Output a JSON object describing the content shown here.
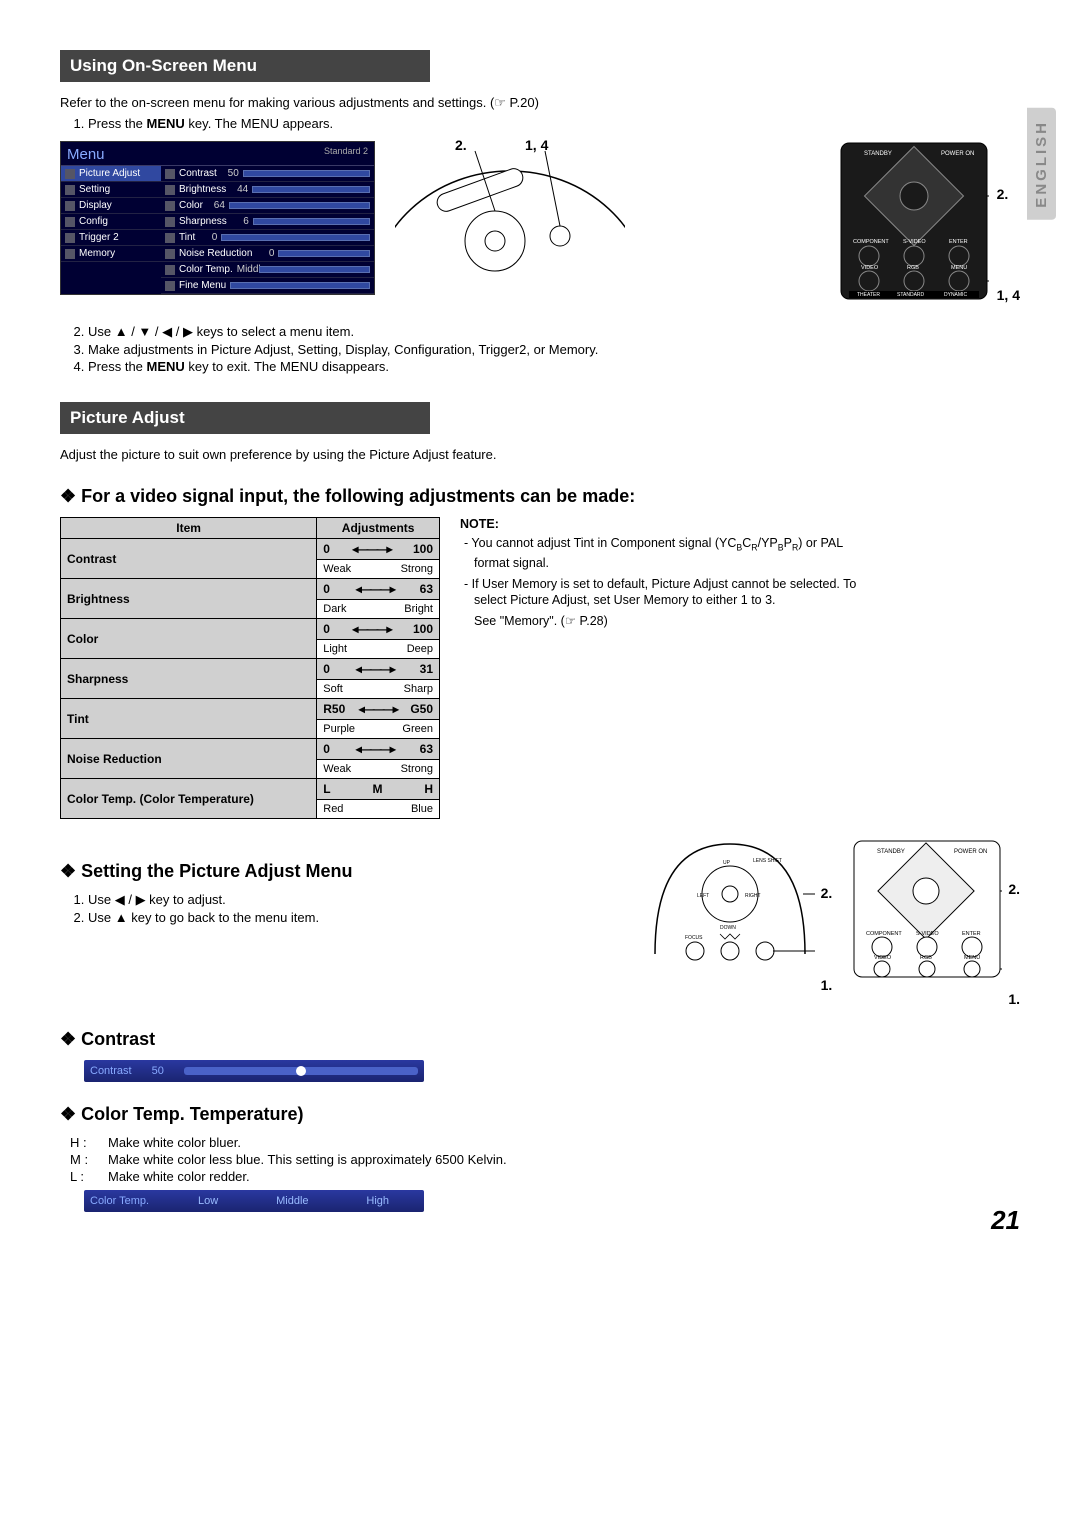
{
  "page_number": "21",
  "language_tab": "ENGLISH",
  "sections": {
    "using_menu": {
      "title": "Using On-Screen Menu",
      "intro": "Refer to the on-screen menu for making various adjustments and settings. (☞ P.20)",
      "step1": "Press the MENU key. The MENU appears.",
      "step2": "Use ▲ / ▼ / ◀ / ▶ keys to select a menu item.",
      "step3": "Make adjustments in Picture Adjust, Setting, Display, Configuration, Trigger2, or Memory.",
      "step4": "Press the MENU key to exit. The MENU disappears.",
      "menu": {
        "title": "Menu",
        "mode": "Standard 2",
        "left_items": [
          "Picture Adjust",
          "Setting",
          "Display",
          "Config",
          "Trigger 2",
          "Memory"
        ],
        "right_items": [
          {
            "label": "Contrast",
            "val": "50"
          },
          {
            "label": "Brightness",
            "val": "44"
          },
          {
            "label": "Color",
            "val": "64"
          },
          {
            "label": "Sharpness",
            "val": "6"
          },
          {
            "label": "Tint",
            "val": "0"
          },
          {
            "label": "Noise Reduction",
            "val": "0"
          },
          {
            "label": "Color Temp.",
            "val": "Middle"
          },
          {
            "label": "Fine Menu",
            "val": ""
          }
        ]
      },
      "callout_2": "2.",
      "callout_14": "1, 4"
    },
    "picture_adjust": {
      "title": "Picture Adjust",
      "intro": "Adjust the picture to suit own preference by using the Picture Adjust feature.",
      "video_heading": "For a video signal input, the following adjustments can be made:",
      "table": {
        "head_item": "Item",
        "head_adj": "Adjustments",
        "rows": [
          {
            "item": "Contrast",
            "lo": "0",
            "hi": "100",
            "dlo": "Weak",
            "dhi": "Strong"
          },
          {
            "item": "Brightness",
            "lo": "0",
            "hi": "63",
            "dlo": "Dark",
            "dhi": "Bright"
          },
          {
            "item": "Color",
            "lo": "0",
            "hi": "100",
            "dlo": "Light",
            "dhi": "Deep"
          },
          {
            "item": "Sharpness",
            "lo": "0",
            "hi": "31",
            "dlo": "Soft",
            "dhi": "Sharp"
          },
          {
            "item": "Tint",
            "lo": "R50",
            "hi": "G50",
            "dlo": "Purple",
            "dhi": "Green"
          },
          {
            "item": "Noise Reduction",
            "lo": "0",
            "hi": "63",
            "dlo": "Weak",
            "dhi": "Strong"
          },
          {
            "item": "Color Temp. (Color Temperature)",
            "lo": "L",
            "mid": "M",
            "hi": "H",
            "dlo": "Red",
            "dhi": "Blue"
          }
        ]
      },
      "note": {
        "title": "NOTE:",
        "n1": "You cannot adjust Tint in Component signal (YCBCR/YPBPR) or PAL format signal.",
        "n2": "If User Memory is set to default, Picture Adjust cannot be selected. To select Picture Adjust, set User Memory to either 1 to 3.",
        "n3": "See \"Memory\". (☞ P.28)"
      },
      "setting_heading": "Setting the Picture Adjust Menu",
      "setting_step1": "Use ◀ / ▶ key to adjust.",
      "setting_step2": "Use ▲ key to go back to the menu item.",
      "contrast_heading": "Contrast",
      "contrast_bar": {
        "label": "Contrast",
        "value": "50"
      },
      "colortemp_heading": "Color Temp. Temperature)",
      "temp": {
        "H": "Make white color bluer.",
        "M": "Make white color less blue. This setting is approximately 6500 Kelvin.",
        "L": "Make white color redder."
      },
      "colortemp_bar": {
        "label": "Color Temp.",
        "low": "Low",
        "mid": "Middle",
        "high": "High"
      }
    },
    "callouts": {
      "c1": "1.",
      "c2": "2.",
      "c14": "1, 4"
    },
    "panel_labels": {
      "standby": "STANDBY",
      "power_on": "POWER ON",
      "component": "COMPONENT",
      "svideo": "S-VIDEO",
      "enter": "ENTER",
      "video": "VIDEO",
      "rgb": "RGB",
      "menu": "MENU",
      "theater": "THEATER",
      "standard": "STANDARD",
      "dynamic": "DYNAMIC"
    },
    "remote_labels": {
      "up": "UP",
      "down": "DOWN",
      "left": "LEFT",
      "right": "RIGHT",
      "lens_shift": "LENS SHIFT",
      "focus": "FOCUS"
    }
  }
}
